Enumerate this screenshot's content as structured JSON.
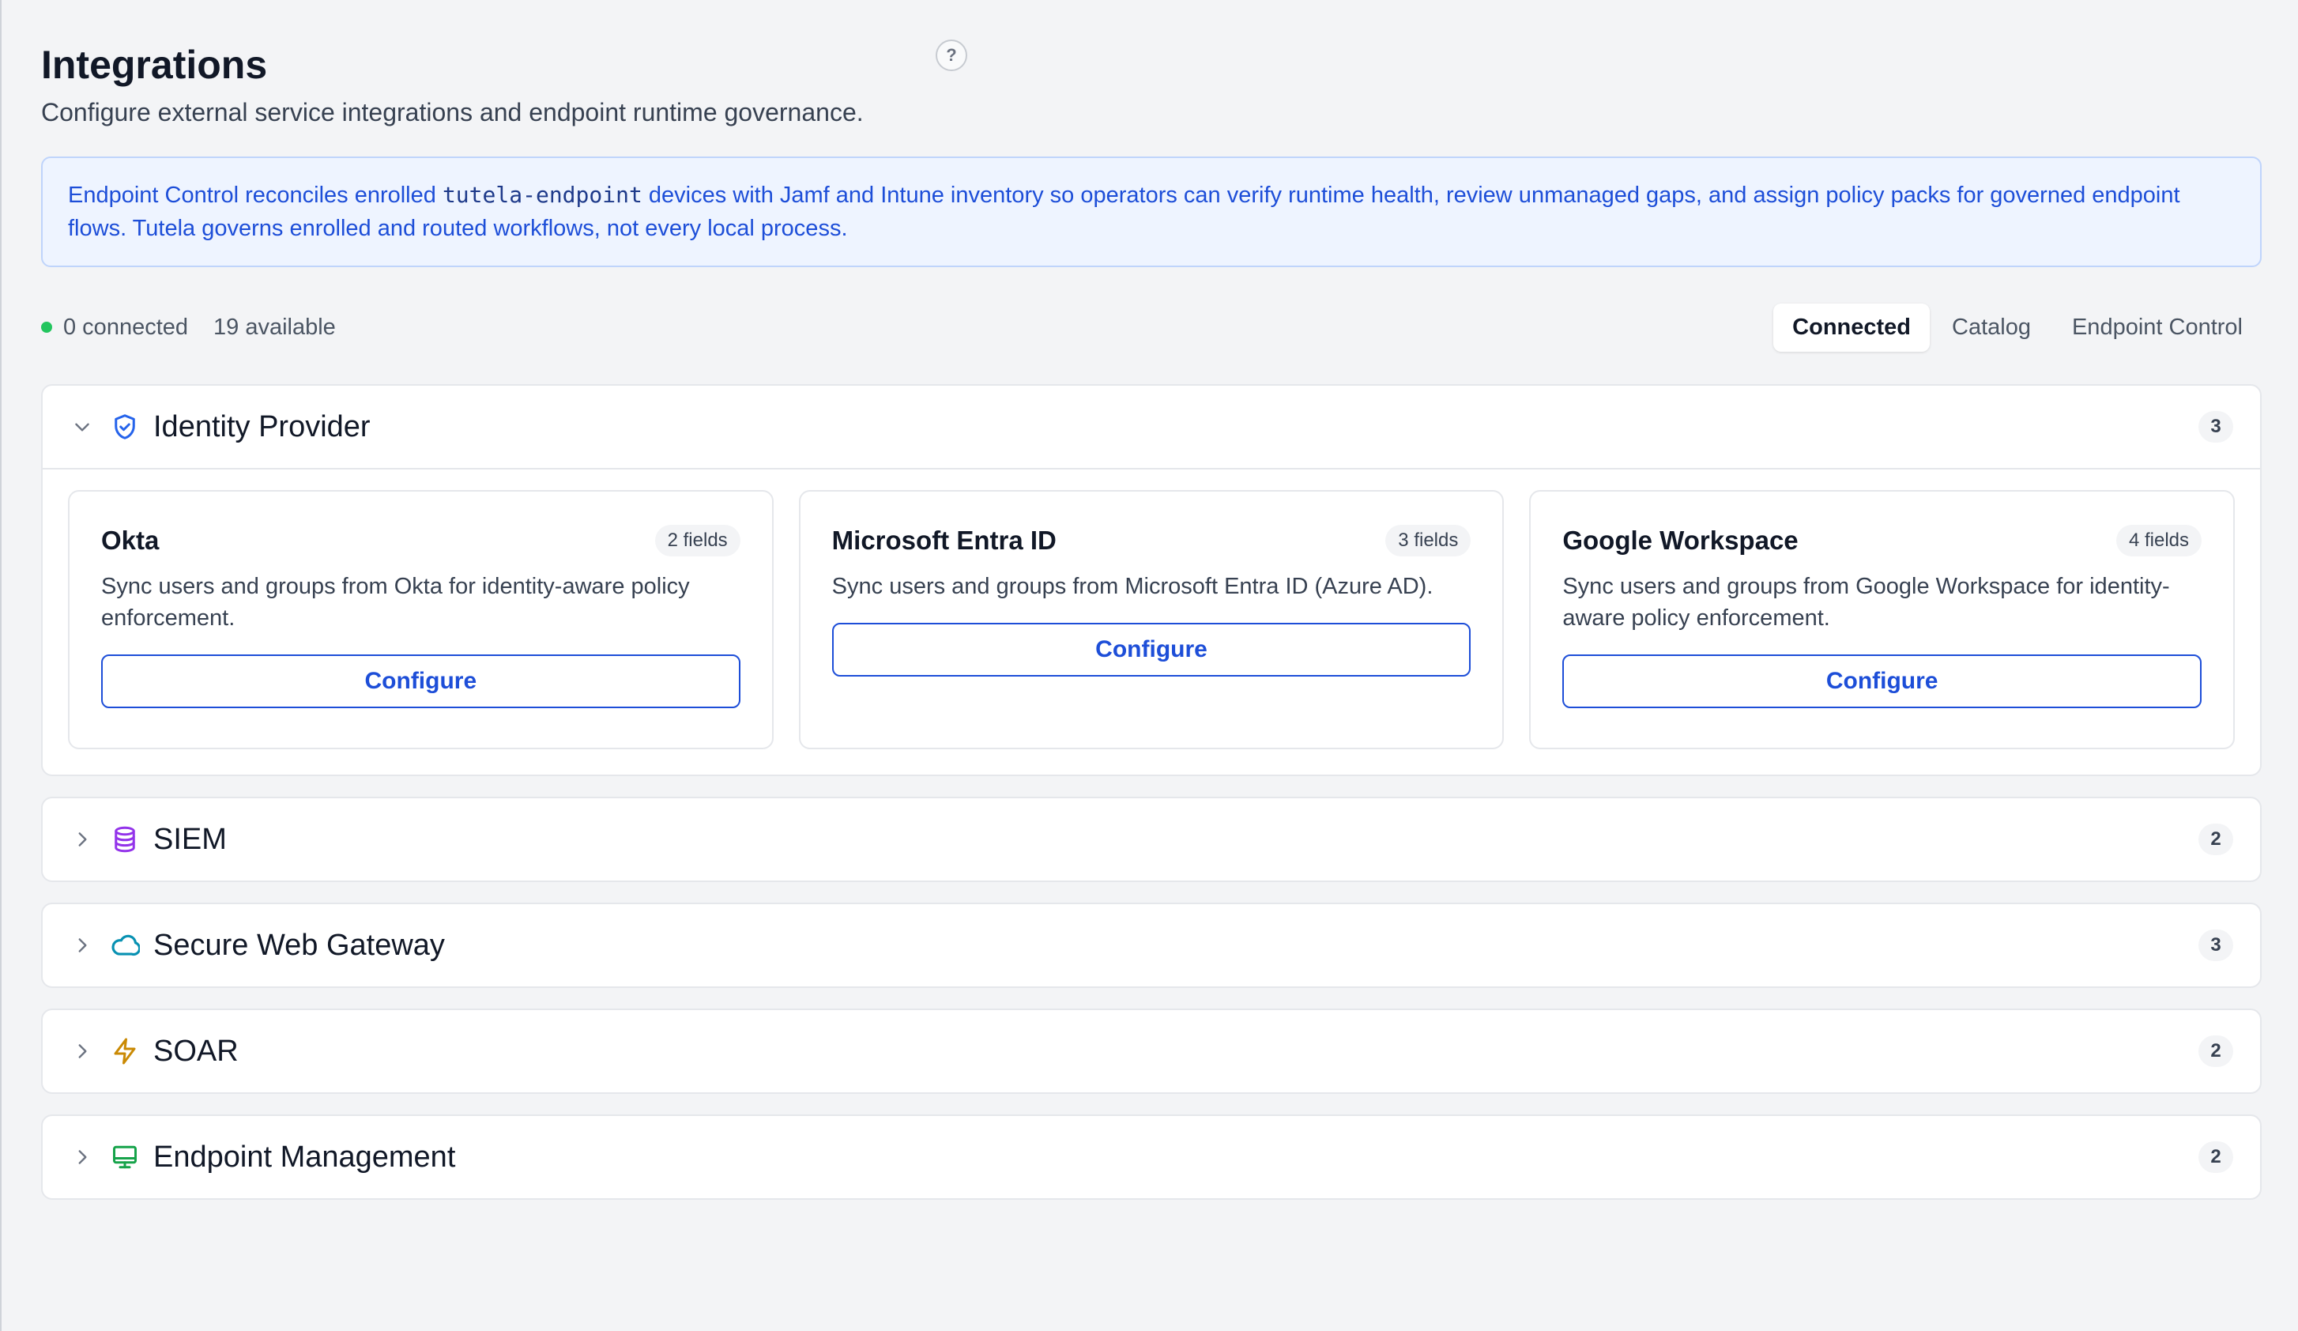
{
  "header": {
    "title": "Integrations",
    "subtitle": "Configure external service integrations and endpoint runtime governance.",
    "help_label": "?"
  },
  "banner": {
    "text_before": "Endpoint Control reconciles enrolled ",
    "code": "tutela-endpoint",
    "text_after": " devices with Jamf and Intune inventory so operators can verify runtime health, review unmanaged gaps, and assign policy packs for governed endpoint flows. Tutela governs enrolled and routed workflows, not every local process."
  },
  "status": {
    "connected": "0 connected",
    "available": "19 available",
    "dot_color": "#22c55e"
  },
  "tabs": [
    {
      "label": "Connected",
      "active": true
    },
    {
      "label": "Catalog",
      "active": false
    },
    {
      "label": "Endpoint Control",
      "active": false
    }
  ],
  "sections": [
    {
      "title": "Identity Provider",
      "count": "3",
      "icon": "shield-check-icon",
      "icon_color": "#2563eb",
      "expanded": true,
      "cards": [
        {
          "title": "Okta",
          "fields": "2 fields",
          "description": "Sync users and groups from Okta for identity-aware policy enforcement.",
          "button": "Configure"
        },
        {
          "title": "Microsoft Entra ID",
          "fields": "3 fields",
          "description": "Sync users and groups from Microsoft Entra ID (Azure AD).",
          "button": "Configure"
        },
        {
          "title": "Google Workspace",
          "fields": "4 fields",
          "description": "Sync users and groups from Google Workspace for identity-aware policy enforcement.",
          "button": "Configure"
        }
      ]
    },
    {
      "title": "SIEM",
      "count": "2",
      "icon": "database-icon",
      "icon_color": "#9333ea",
      "expanded": false
    },
    {
      "title": "Secure Web Gateway",
      "count": "3",
      "icon": "cloud-icon",
      "icon_color": "#0891b2",
      "expanded": false
    },
    {
      "title": "SOAR",
      "count": "2",
      "icon": "lightning-icon",
      "icon_color": "#ca8a04",
      "expanded": false
    },
    {
      "title": "Endpoint Management",
      "count": "2",
      "icon": "monitor-icon",
      "icon_color": "#16a34a",
      "expanded": false
    }
  ]
}
